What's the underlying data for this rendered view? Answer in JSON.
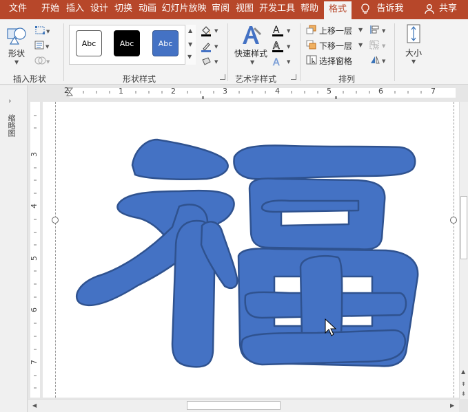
{
  "tabs": [
    {
      "label": "文件"
    },
    {
      "label": "开始"
    },
    {
      "label": "插入"
    },
    {
      "label": "设计"
    },
    {
      "label": "切换"
    },
    {
      "label": "动画"
    },
    {
      "label": "幻灯片放映"
    },
    {
      "label": "审阅"
    },
    {
      "label": "视图"
    },
    {
      "label": "开发工具"
    },
    {
      "label": "帮助"
    },
    {
      "label": "格式"
    }
  ],
  "tell_me": "告诉我",
  "share": "共享",
  "ribbon": {
    "insert_shapes": {
      "shape_label": "形状",
      "group_label": "插入形状"
    },
    "shape_styles": {
      "group_label": "形状样式",
      "presets": [
        {
          "label": "Abc",
          "bg": "#ffffff",
          "fg": "#000000",
          "border": "#555555"
        },
        {
          "label": "Abc",
          "bg": "#000000",
          "fg": "#ffffff",
          "border": "#000000"
        },
        {
          "label": "Abc",
          "bg": "#4472c4",
          "fg": "#ffffff",
          "border": "#2f528f"
        }
      ]
    },
    "wordart": {
      "quick_styles_label": "快速样式",
      "group_label": "艺术字样式"
    },
    "arrange": {
      "bring_forward": "上移一层",
      "send_backward": "下移一层",
      "selection_pane": "选择窗格",
      "group_label": "排列"
    },
    "size": {
      "label": "大小"
    }
  },
  "left_pane": {
    "label": "缩略图"
  },
  "ruler": {
    "h_numbers": [
      "2",
      "1",
      "1",
      "2",
      "3",
      "4",
      "5",
      "6",
      "7"
    ],
    "v_numbers": [
      "3",
      "4",
      "5",
      "6",
      "7"
    ]
  },
  "colors": {
    "accent": "#b7472a",
    "shape_fill": "#4472c4",
    "shape_stroke": "#2f528f"
  }
}
